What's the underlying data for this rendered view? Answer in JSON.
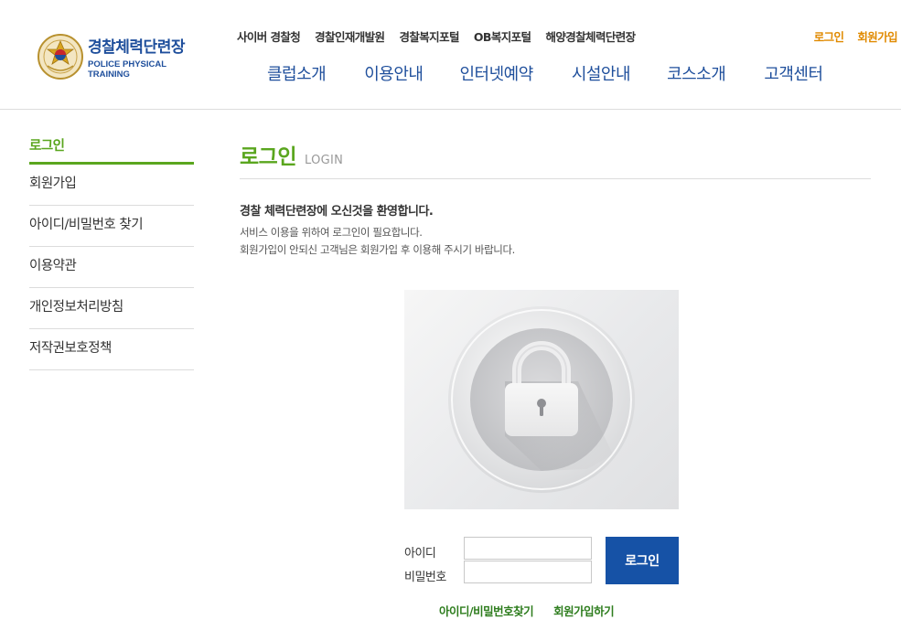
{
  "brand": {
    "title": "경찰체력단련장",
    "subtitle": "POLICE PHYSICAL TRAINING",
    "emblem_icon": "police-emblem-icon",
    "colors": {
      "primary_blue": "#1f4f9c",
      "accent_green": "#5aa61e",
      "auth_orange": "#e08a00",
      "button_blue": "#1652a6"
    }
  },
  "util_nav": [
    "사이버 경찰청",
    "경찰인재개발원",
    "경찰복지포털",
    "OB복지포털",
    "해양경찰체력단련장"
  ],
  "auth_nav": {
    "login": "로그인",
    "signup": "회원가입"
  },
  "gnb": [
    "클럽소개",
    "이용안내",
    "인터넷예약",
    "시설안내",
    "코스소개",
    "고객센터"
  ],
  "sidebar": {
    "items": [
      {
        "label": "로그인",
        "active": true
      },
      {
        "label": "회원가입"
      },
      {
        "label": "아이디/비밀번호 찾기"
      },
      {
        "label": "이용약관"
      },
      {
        "label": "개인정보처리방침"
      },
      {
        "label": "저작권보호정책"
      }
    ]
  },
  "content": {
    "title": "로그인",
    "title_en": "LOGIN",
    "welcome": "경찰 체력단련장에 오신것을 환영합니다.",
    "desc_line1": "서비스 이용을 위하여 로그인이 필요합니다.",
    "desc_line2": "회원가입이 안되신 고객님은 회원가입 후 이용해 주시기 바랍니다.",
    "lock_icon": "lock-icon"
  },
  "login_form": {
    "id_label": "아이디",
    "pw_label": "비밀번호",
    "id_value": "",
    "pw_value": "",
    "submit_label": "로그인",
    "find_link": "아이디/비밀번호찾기",
    "signup_link": "회원가입하기"
  }
}
